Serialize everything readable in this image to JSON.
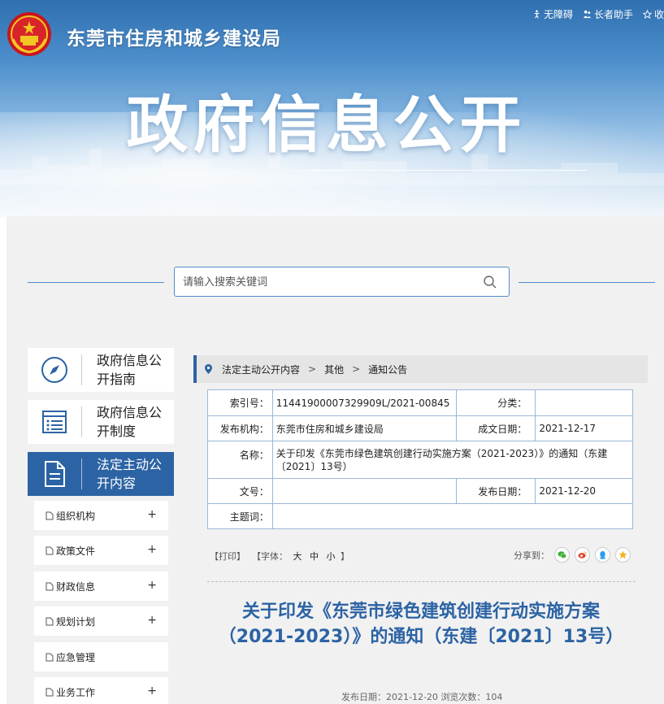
{
  "header": {
    "site_name": "东莞市住房和城乡建设局",
    "top_links": [
      "无障碍",
      "长者助手",
      "收"
    ],
    "banner_title": "政府信息公开"
  },
  "search": {
    "placeholder": "请输入搜索关键词"
  },
  "sidebar": {
    "cards": [
      {
        "label": "政府信息公开指南",
        "icon": "compass-icon"
      },
      {
        "label": "政府信息公开制度",
        "icon": "list-doc-icon"
      },
      {
        "label": "法定主动公开内容",
        "icon": "document-icon",
        "active": true
      }
    ],
    "items": [
      {
        "label": "组织机构",
        "expandable": true
      },
      {
        "label": "政策文件",
        "expandable": true
      },
      {
        "label": "财政信息",
        "expandable": true
      },
      {
        "label": "规划计划",
        "expandable": true
      },
      {
        "label": "应急管理",
        "expandable": false
      },
      {
        "label": "业务工作",
        "expandable": true
      }
    ],
    "plus_symbol": "+"
  },
  "breadcrumb": [
    "法定主动公开内容",
    "其他",
    "通知公告"
  ],
  "breadcrumb_sep": ">",
  "meta_table": {
    "index_label": "索引号：",
    "index_value": "11441900007329909L/2021-00845",
    "category_label": "分类：",
    "category_value": "",
    "publisher_label": "发布机构：",
    "publisher_value": "东莞市住房和城乡建设局",
    "created_label": "成文日期：",
    "created_value": "2021-12-17",
    "name_label": "名称：",
    "name_value": "关于印发《东莞市绿色建筑创建行动实施方案（2021-2023）》的通知（东建〔2021〕13号）",
    "docno_label": "文号：",
    "docno_value": "",
    "published_label": "发布日期：",
    "published_value": "2021-12-20",
    "subject_label": "主题词：",
    "subject_value": ""
  },
  "tools": {
    "print": "【打印】",
    "font_label": "【字体：",
    "font_large": "大",
    "font_medium": "中",
    "font_small": "小",
    "font_close": "】",
    "share_label": "分享到："
  },
  "colors": {
    "brand_blue": "#2c63a4",
    "title_blue": "#2c63a4",
    "wechat": "#3cb034",
    "weibo": "#e6442b",
    "qq": "#2d9cf0",
    "qzone": "#f5b21b"
  },
  "article": {
    "title": "关于印发《东莞市绿色建筑创建行动实施方案（2021-2023）》的通知（东建〔2021〕13号）",
    "meta": "发布日期：2021-12-20  浏览次数：104"
  }
}
